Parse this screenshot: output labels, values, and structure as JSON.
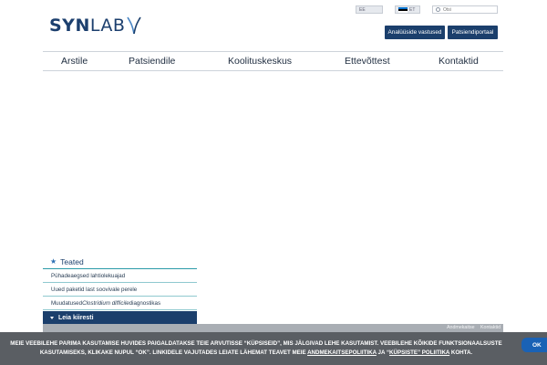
{
  "header": {
    "logo": {
      "bold": "SYN",
      "light": "LAB"
    },
    "accessibility_label": "EE",
    "language_label": "ET",
    "search": {
      "placeholder": "Otsi"
    },
    "buttons": {
      "faq": "Analüüside vastused",
      "portal": "Patsiendiportaal"
    }
  },
  "nav": {
    "items": [
      {
        "label": "Arstile"
      },
      {
        "label": "Patsiendile"
      },
      {
        "label": "Koolituskeskus"
      },
      {
        "label": "Ettevõttest"
      },
      {
        "label": "Kontaktid"
      }
    ]
  },
  "sidebar": {
    "notices_title": "Teated",
    "notices": [
      {
        "text": "Pühadeaegsed lahtiolekuajad"
      },
      {
        "text": "Uued paketid last soovivale perele"
      },
      {
        "prefix": "Muudatused ",
        "italic": "Clostridium difficile",
        "suffix": " diagnostikas"
      }
    ],
    "quick_find": "Leia kiiresti"
  },
  "footer": {
    "links": {
      "privacy": "Andmekaitse",
      "contact": "Kontaktid"
    }
  },
  "cookie_banner": {
    "line1": "MEIE VEEBILEHE PARIMA KASUTAMISE HUVIDES PAIGALDATAKSE TEIE ARVUTISSE “KÜPSISEID”, MIS JÄLGIVAD LEHE KASUTAMIST. VEEBILEHE KÕIKIDE FUNKTSIONAALSUSTE",
    "line2_prefix": "KASUTAMISEKS, KLIKAKE NUPUL “OK”. LINKIDELE VAJUTADES LEIATE LÄHEMAT TEAVET MEIE ",
    "link_privacy": "ANDMEKAITSEPOLIITIKA",
    "line2_mid": " JA “",
    "link_cookies": "KÜPSISTE” POLIITIKA",
    "line2_suffix": " KOHTA.",
    "ok_label": "OK"
  },
  "colors": {
    "brand_navy": "#1b3f6c",
    "accent_teal": "#2b9aa8",
    "logo_accent": "#4a86c5",
    "cookie_bg": "#5a5e63",
    "ok_blue": "#1a62b5",
    "flag_blue": "#0072ce",
    "flag_black": "#000000",
    "flag_white": "#ffffff"
  }
}
